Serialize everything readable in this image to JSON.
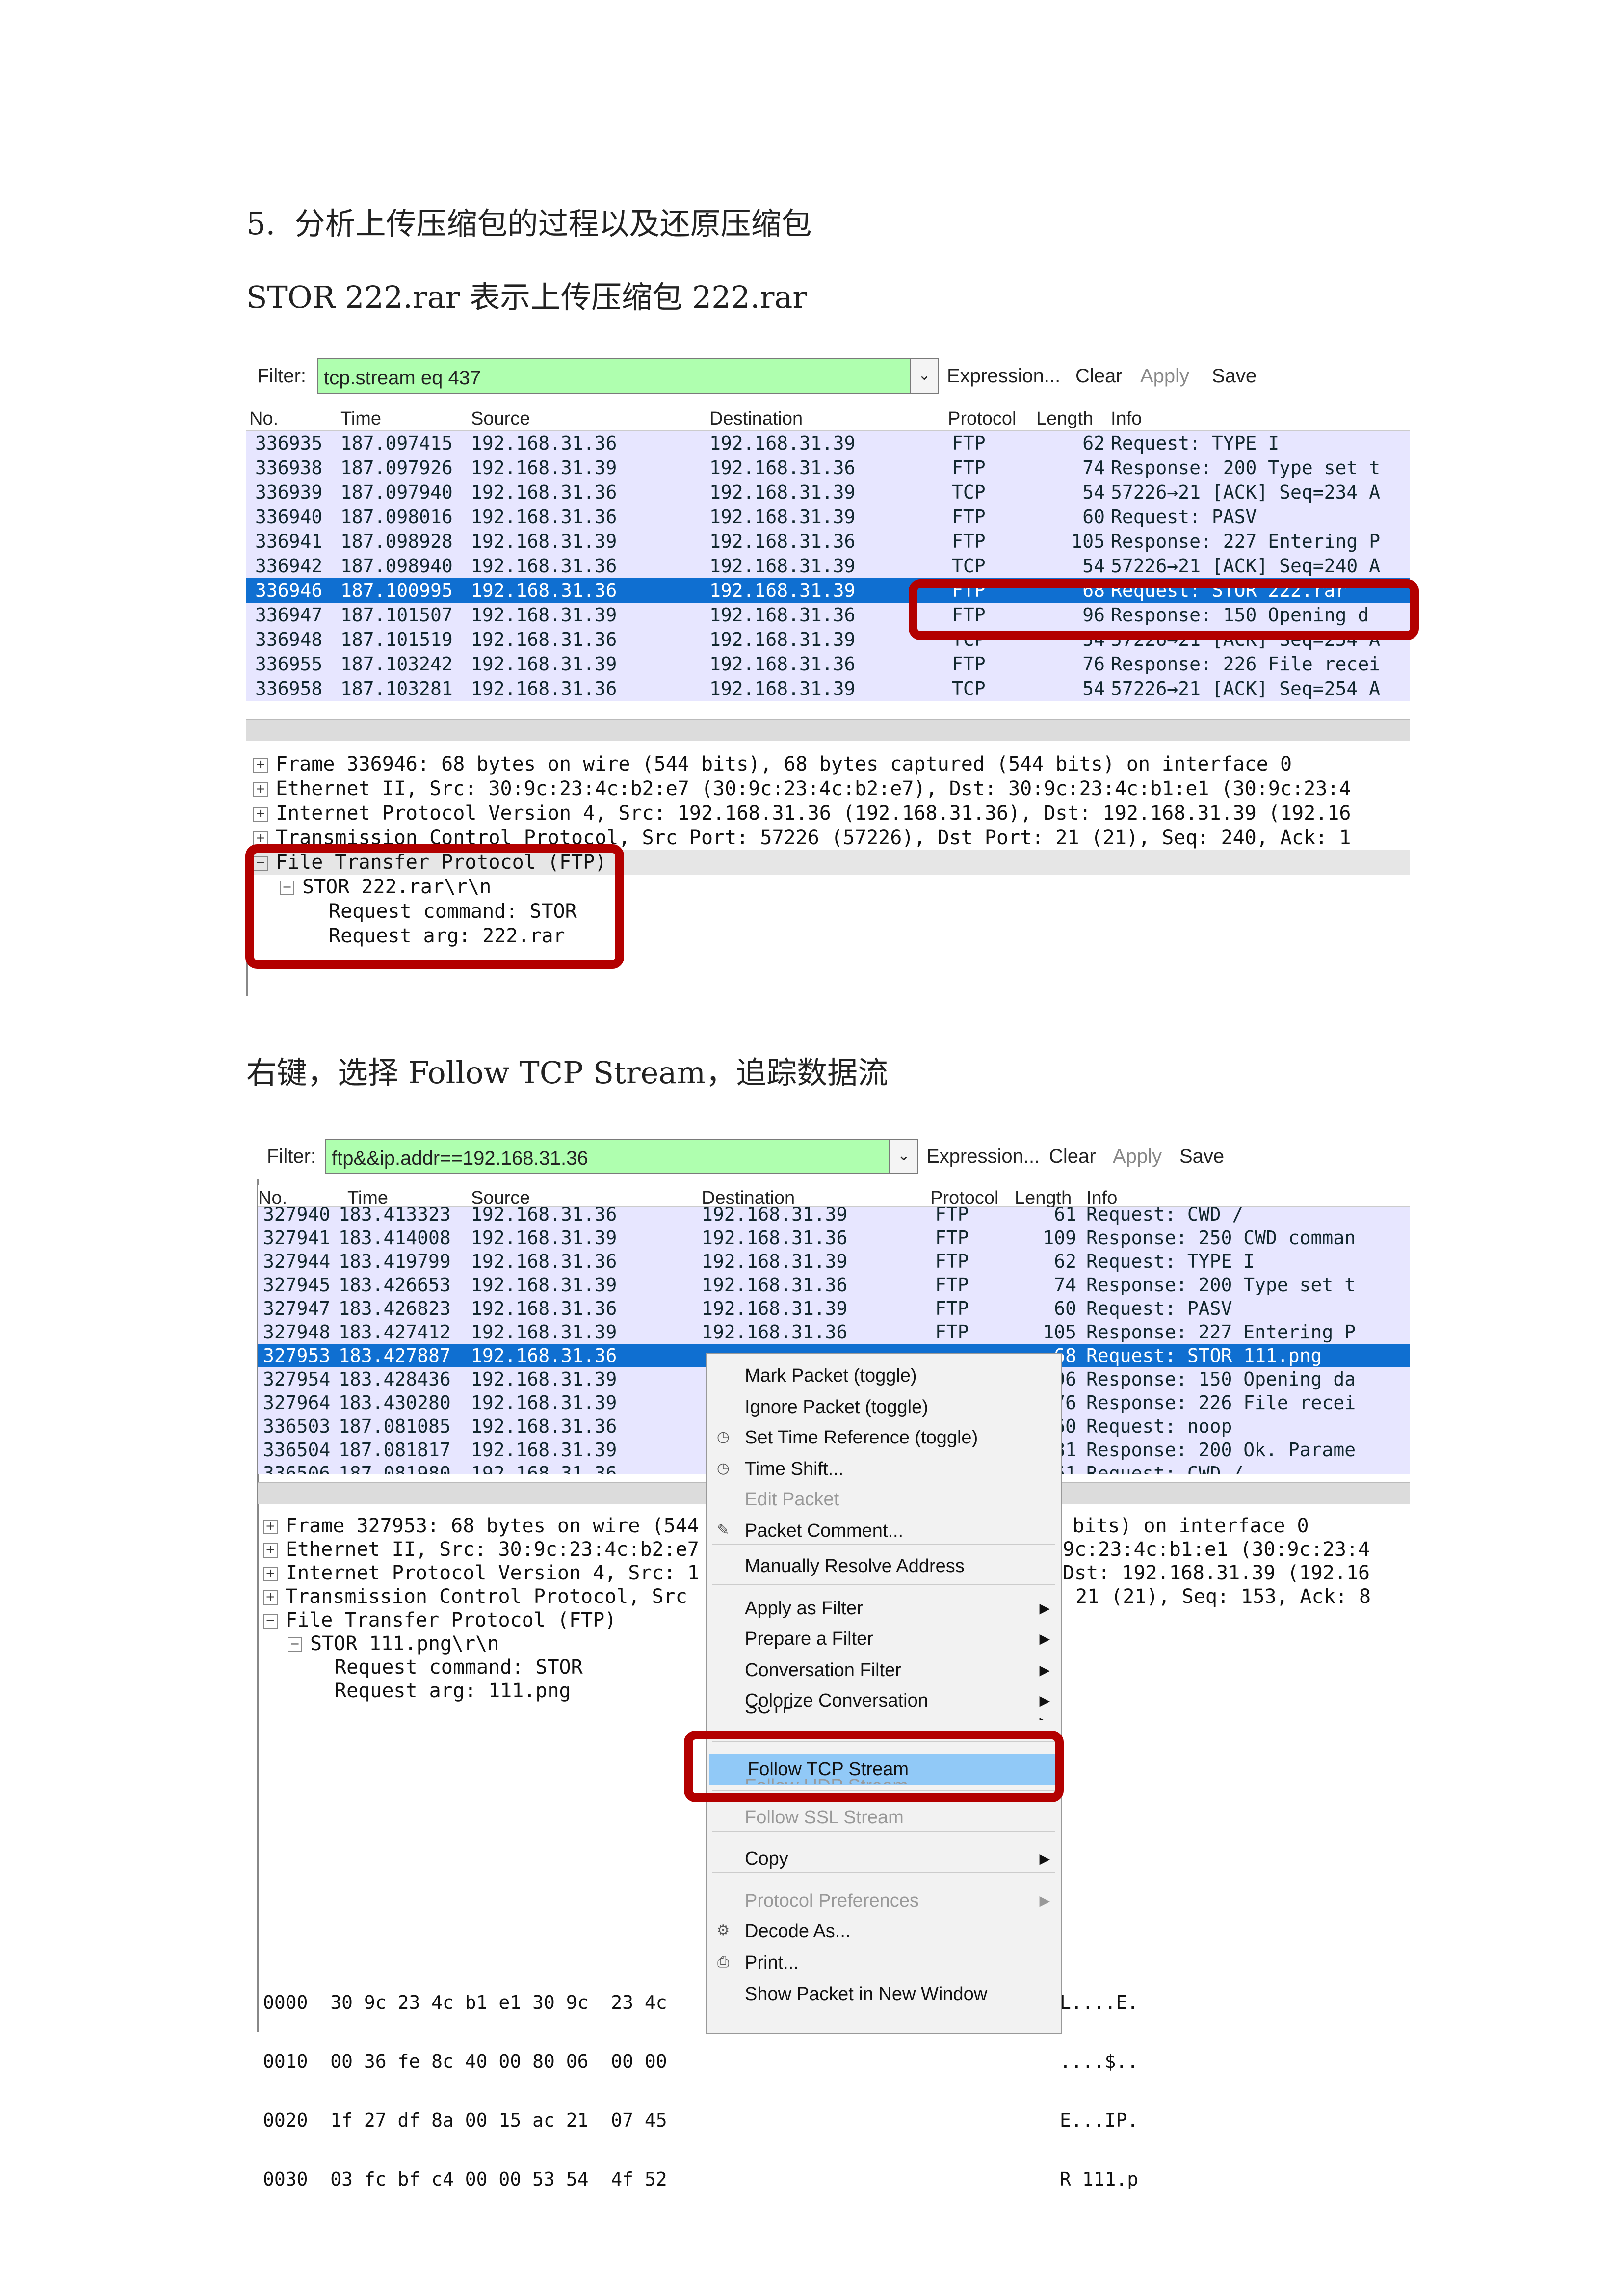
{
  "document": {
    "heading": "5.  分析上传压缩包的过程以及还原压缩包",
    "line2": "STOR 222.rar 表示上传压缩包 222.rar",
    "caption2": "右键，选择 Follow TCP Stream，追踪数据流"
  },
  "shot1": {
    "toolbar": {
      "filter_label": "Filter:",
      "filter_value": "tcp.stream eq 437",
      "expression": "Expression...",
      "clear": "Clear",
      "apply": "Apply",
      "save": "Save"
    },
    "columns": {
      "no": "No.",
      "time": "Time",
      "source": "Source",
      "destination": "Destination",
      "protocol": "Protocol",
      "length": "Length",
      "info": "Info"
    },
    "rows": [
      {
        "no": "336935",
        "time": "187.097415",
        "src": "192.168.31.36",
        "dst": "192.168.31.39",
        "proto": "FTP",
        "len": "62",
        "info": "Request: TYPE I"
      },
      {
        "no": "336938",
        "time": "187.097926",
        "src": "192.168.31.39",
        "dst": "192.168.31.36",
        "proto": "FTP",
        "len": "74",
        "info": "Response: 200 Type set t"
      },
      {
        "no": "336939",
        "time": "187.097940",
        "src": "192.168.31.36",
        "dst": "192.168.31.39",
        "proto": "TCP",
        "len": "54",
        "info": "57226→21 [ACK] Seq=234 A"
      },
      {
        "no": "336940",
        "time": "187.098016",
        "src": "192.168.31.36",
        "dst": "192.168.31.39",
        "proto": "FTP",
        "len": "60",
        "info": "Request: PASV"
      },
      {
        "no": "336941",
        "time": "187.098928",
        "src": "192.168.31.39",
        "dst": "192.168.31.36",
        "proto": "FTP",
        "len": "105",
        "info": "Response: 227 Entering P"
      },
      {
        "no": "336942",
        "time": "187.098940",
        "src": "192.168.31.36",
        "dst": "192.168.31.39",
        "proto": "TCP",
        "len": "54",
        "info": "57226→21 [ACK] Seq=240 A"
      },
      {
        "no": "336946",
        "time": "187.100995",
        "src": "192.168.31.36",
        "dst": "192.168.31.39",
        "proto": "FTP",
        "len": "68",
        "info": "Request: STOR 222.rar"
      },
      {
        "no": "336947",
        "time": "187.101507",
        "src": "192.168.31.39",
        "dst": "192.168.31.36",
        "proto": "FTP",
        "len": "96",
        "info": "Response: 150 Opening d"
      },
      {
        "no": "336948",
        "time": "187.101519",
        "src": "192.168.31.36",
        "dst": "192.168.31.39",
        "proto": "TCP",
        "len": "54",
        "info": "57226→21 [ACK] Seq=254 A"
      },
      {
        "no": "336955",
        "time": "187.103242",
        "src": "192.168.31.39",
        "dst": "192.168.31.36",
        "proto": "FTP",
        "len": "76",
        "info": "Response: 226 File recei"
      },
      {
        "no": "336958",
        "time": "187.103281",
        "src": "192.168.31.36",
        "dst": "192.168.31.39",
        "proto": "TCP",
        "len": "54",
        "info": "57226→21 [ACK] Seq=254 A"
      }
    ],
    "details": [
      "Frame 336946: 68 bytes on wire (544 bits), 68 bytes captured (544 bits) on interface 0",
      "Ethernet II, Src: 30:9c:23:4c:b2:e7 (30:9c:23:4c:b2:e7), Dst: 30:9c:23:4c:b1:e1 (30:9c:23:4",
      "Internet Protocol Version 4, Src: 192.168.31.36 (192.168.31.36), Dst: 192.168.31.39 (192.16",
      "Transmission Control Protocol, Src Port: 57226 (57226), Dst Port: 21 (21), Seq: 240, Ack: 1",
      "File Transfer Protocol (FTP)",
      "STOR 222.rar\\r\\n",
      "Request command: STOR",
      "Request arg: 222.rar"
    ]
  },
  "shot2": {
    "toolbar": {
      "filter_label": "Filter:",
      "filter_value": "ftp&&ip.addr==192.168.31.36",
      "expression": "Expression...",
      "clear": "Clear",
      "apply": "Apply",
      "save": "Save"
    },
    "columns": {
      "no": "No.",
      "time": "Time",
      "source": "Source",
      "destination": "Destination",
      "protocol": "Protocol",
      "length": "Length",
      "info": "Info"
    },
    "rows": [
      {
        "no": "327940",
        "time": "183.413323",
        "src": "192.168.31.36",
        "dst": "192.168.31.39",
        "proto": "FTP",
        "len": "61",
        "info": "Request: CWD /"
      },
      {
        "no": "327941",
        "time": "183.414008",
        "src": "192.168.31.39",
        "dst": "192.168.31.36",
        "proto": "FTP",
        "len": "109",
        "info": "Response: 250 CWD comman"
      },
      {
        "no": "327944",
        "time": "183.419799",
        "src": "192.168.31.36",
        "dst": "192.168.31.39",
        "proto": "FTP",
        "len": "62",
        "info": "Request: TYPE I"
      },
      {
        "no": "327945",
        "time": "183.426653",
        "src": "192.168.31.39",
        "dst": "192.168.31.36",
        "proto": "FTP",
        "len": "74",
        "info": "Response: 200 Type set t"
      },
      {
        "no": "327947",
        "time": "183.426823",
        "src": "192.168.31.36",
        "dst": "192.168.31.39",
        "proto": "FTP",
        "len": "60",
        "info": "Request: PASV"
      },
      {
        "no": "327948",
        "time": "183.427412",
        "src": "192.168.31.39",
        "dst": "192.168.31.36",
        "proto": "FTP",
        "len": "105",
        "info": "Response: 227 Entering P"
      },
      {
        "no": "327953",
        "time": "183.427887",
        "src": "192.168.31.36",
        "dst": "",
        "proto": "",
        "len": "68",
        "info": "Request: STOR 111.png"
      },
      {
        "no": "327954",
        "time": "183.428436",
        "src": "192.168.31.39",
        "dst": "",
        "proto": "",
        "len": "96",
        "info": "Response: 150 Opening da"
      },
      {
        "no": "327964",
        "time": "183.430280",
        "src": "192.168.31.39",
        "dst": "",
        "proto": "",
        "len": "76",
        "info": "Response: 226 File recei"
      },
      {
        "no": "336503",
        "time": "187.081085",
        "src": "192.168.31.36",
        "dst": "",
        "proto": "",
        "len": "60",
        "info": "Request: noop"
      },
      {
        "no": "336504",
        "time": "187.081817",
        "src": "192.168.31.39",
        "dst": "",
        "proto": "",
        "len": "81",
        "info": "Response: 200 Ok. Parame"
      },
      {
        "no": "336506",
        "time": "187.081980",
        "src": "192.168.31.36",
        "dst": "",
        "proto": "",
        "len": "61",
        "info": "Request: CWD /"
      }
    ],
    "details_left": [
      "Frame 327953: 68 bytes on wire (544",
      "Ethernet II, Src: 30:9c:23:4c:b2:e7",
      "Internet Protocol Version 4, Src: 1",
      "Transmission Control Protocol, Src",
      "File Transfer Protocol (FTP)",
      "STOR 111.png\\r\\n",
      "Request command: STOR",
      "Request arg: 111.png"
    ],
    "details_right": [
      "bits) on interface 0",
      "9c:23:4c:b1:e1 (30:9c:23:4",
      "Dst: 192.168.31.39 (192.16",
      "21 (21), Seq: 153, Ack: 8"
    ],
    "hex_left": [
      "0000  30 9c 23 4c b1 e1 30 9c  23 4c",
      "0010  00 36 fe 8c 40 00 80 06  00 00",
      "0020  1f 27 df 8a 00 15 ac 21  07 45",
      "0030  03 fc bf c4 00 00 53 54  4f 52"
    ],
    "hex_right": [
      "L....E.",
      "....$..",
      "E...IP.",
      "R 111.p"
    ],
    "menu": {
      "items": [
        {
          "label": "Mark Packet (toggle)"
        },
        {
          "label": "Ignore Packet (toggle)"
        },
        {
          "label": "Set Time Reference (toggle)",
          "icon": "clock-icon"
        },
        {
          "label": "Time Shift...",
          "icon": "clock-icon"
        },
        {
          "label": "Edit Packet",
          "dim": true
        },
        {
          "label": "Packet Comment...",
          "icon": "comment-icon"
        },
        {
          "label": "Manually Resolve Address"
        },
        {
          "label": "Apply as Filter",
          "sub": true
        },
        {
          "label": "Prepare a Filter",
          "sub": true
        },
        {
          "label": "Conversation Filter",
          "sub": true
        },
        {
          "label": "Colorize Conversation",
          "sub": true
        },
        {
          "label": "SCTP",
          "sub": true
        },
        {
          "label": "Follow TCP Stream",
          "highlight": true
        },
        {
          "label": "Follow UDP Stream",
          "dim": true
        },
        {
          "label": "Follow SSL Stream",
          "dim": true
        },
        {
          "label": "Copy",
          "sub": true
        },
        {
          "label": "Protocol Preferences",
          "dim": true,
          "sub": true
        },
        {
          "label": "Decode As...",
          "icon": "decode-icon"
        },
        {
          "label": "Print...",
          "icon": "print-icon"
        },
        {
          "label": "Show Packet in New Window"
        }
      ]
    }
  }
}
